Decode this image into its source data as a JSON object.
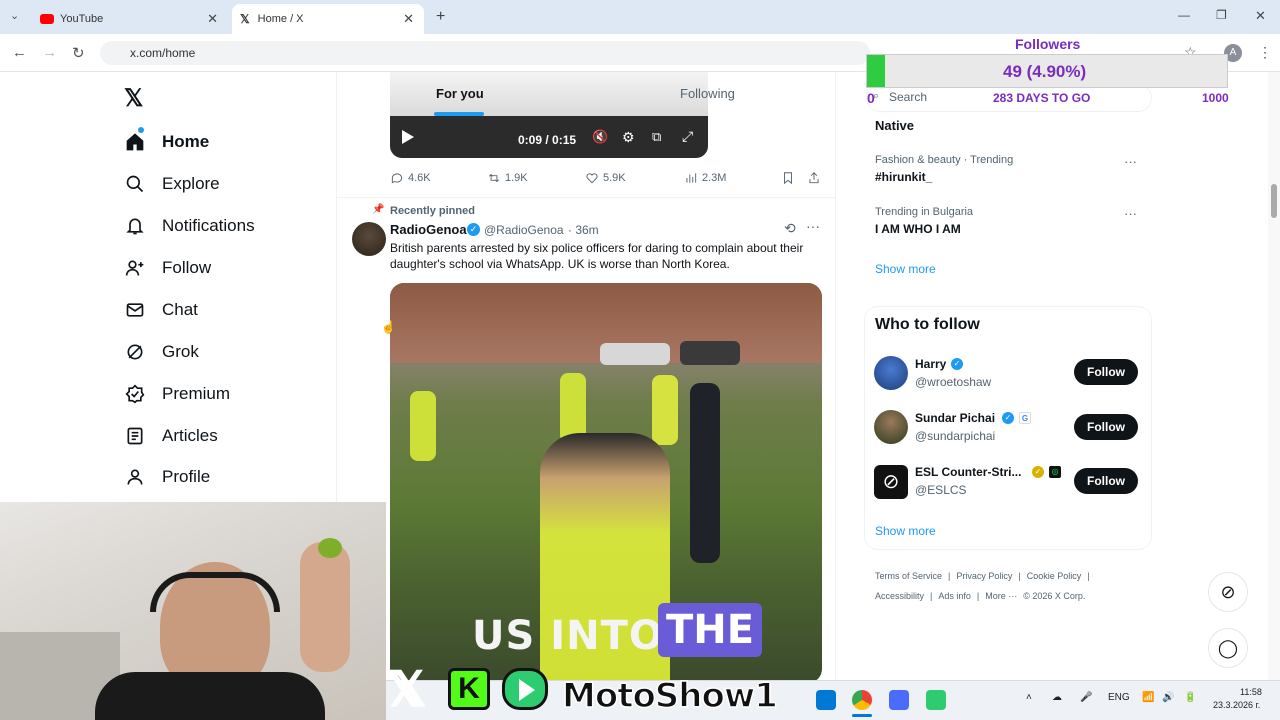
{
  "browser": {
    "tabs": [
      {
        "title": "YouTube",
        "active": false
      },
      {
        "title": "Home / X",
        "active": true
      }
    ],
    "url": "x.com/home"
  },
  "sidebar": {
    "items": [
      {
        "label": "Home",
        "icon": "home-icon"
      },
      {
        "label": "Explore",
        "icon": "search-icon"
      },
      {
        "label": "Notifications",
        "icon": "bell-icon"
      },
      {
        "label": "Follow",
        "icon": "person-plus-icon"
      },
      {
        "label": "Chat",
        "icon": "mail-icon"
      },
      {
        "label": "Grok",
        "icon": "grok-icon"
      },
      {
        "label": "Premium",
        "icon": "verified-icon"
      },
      {
        "label": "Articles",
        "icon": "article-icon"
      },
      {
        "label": "Profile",
        "icon": "person-icon"
      }
    ]
  },
  "feed": {
    "tabs": [
      "For you",
      "Following"
    ],
    "video1": {
      "time": "0:09 / 0:15"
    },
    "stats": {
      "replies": "4.6K",
      "reposts": "1.9K",
      "likes": "5.9K",
      "views": "2.3M"
    },
    "post": {
      "pinned_label": "Recently pinned",
      "author": "RadioGenoa",
      "handle": "@RadioGenoa",
      "time": "· 36m",
      "text": "British parents arrested by six police officers for daring to complain about their daughter's school via WhatsApp. UK is worse than North Korea.",
      "caption_a": "US INTO ",
      "caption_b": "THE"
    }
  },
  "right": {
    "search_placeholder": "Search",
    "trend_top": "Native",
    "trends": [
      {
        "context": "Fashion & beauty · Trending",
        "name": "#hirunkit_"
      },
      {
        "context": "Trending in Bulgaria",
        "name": "I AM WHO I AM"
      }
    ],
    "show_more": "Show more",
    "who_to_follow": {
      "title": "Who to follow",
      "users": [
        {
          "name": "Harry",
          "handle": "@wroetoshaw"
        },
        {
          "name": "Sundar Pichai",
          "handle": "@sundarpichai"
        },
        {
          "name": "ESL Counter-Stri...",
          "handle": "@ESLCS"
        }
      ],
      "follow_label": "Follow",
      "show_more": "Show more"
    },
    "footer": {
      "links": [
        "Terms of Service",
        "Privacy Policy",
        "Cookie Policy",
        "Accessibility",
        "Ads info",
        "More ···"
      ],
      "copyright": "© 2026 X Corp."
    }
  },
  "overlay": {
    "followers_title": "Followers",
    "followers_count": "49 (4.90%)",
    "progress_fraction": 0.049,
    "start": "0",
    "goal": "1000",
    "days_left": "283 DAYS TO GO",
    "channel_name": "MotoShow1"
  },
  "taskbar": {
    "lang": "ENG",
    "time": "11:58",
    "date": "23.3.2026 г."
  }
}
